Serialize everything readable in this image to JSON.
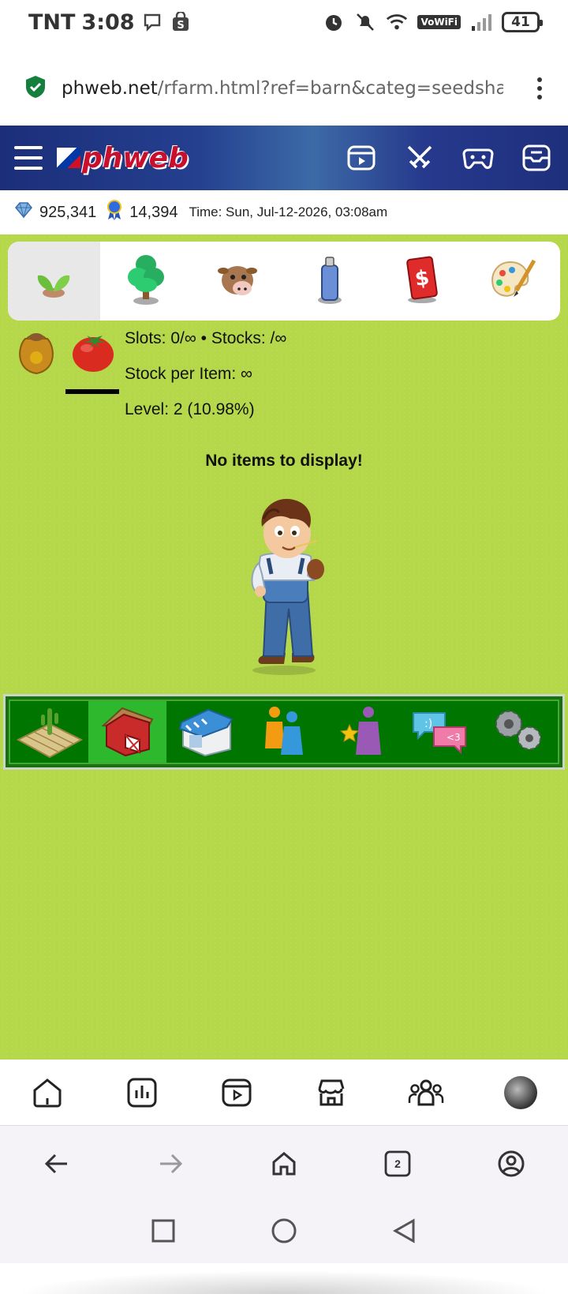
{
  "status_bar": {
    "carrier": "TNT",
    "time": "3:08",
    "vowifi": "VoWiFi",
    "battery": "41"
  },
  "browser": {
    "url_host": "phweb.net",
    "url_path": "/rfarm.html?ref=barn&categ=seedsha",
    "tabs_count": "2"
  },
  "site": {
    "logo": "phweb"
  },
  "info": {
    "gems": "925,341",
    "ribbons": "14,394",
    "time": "Time: Sun, Jul-12-2026, 03:08am"
  },
  "barn": {
    "slots_stocks": "Slots: 0/∞ • Stocks: /∞",
    "stock_per_item": "Stock per Item: ∞",
    "level": "Level: 2 (10.98%)",
    "empty_message": "No items to display!"
  },
  "category_tabs": [
    "seeds",
    "trees",
    "animals",
    "spray",
    "cash",
    "paint"
  ],
  "game_nav": [
    "farm",
    "barn",
    "shop",
    "neighbors",
    "achievements",
    "chat",
    "settings"
  ],
  "colors": {
    "grass": "#b5d74a",
    "nav_green": "#007600",
    "nav_active": "#2eb82e",
    "header_blue": "#24408f"
  }
}
